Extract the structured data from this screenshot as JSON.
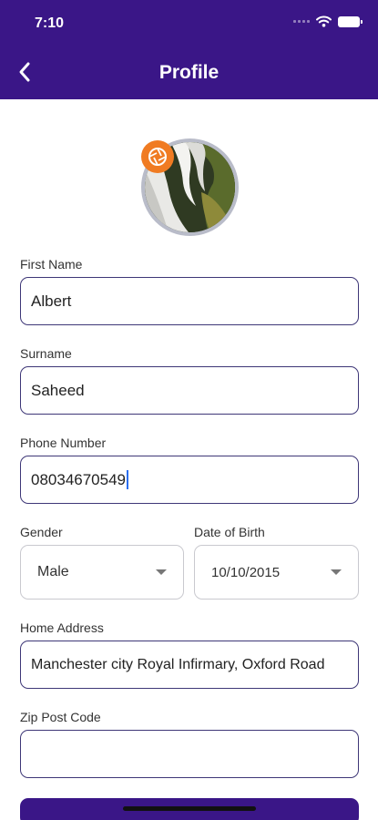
{
  "status_bar": {
    "time": "7:10"
  },
  "header": {
    "title": "Profile"
  },
  "colors": {
    "header_bg": "#3a1687",
    "accent": "#f07b22",
    "field_border": "#3e3777"
  },
  "icons": {
    "back": "chevron-left-icon",
    "camera": "camera-aperture-icon"
  },
  "form": {
    "first_name": {
      "label": "First Name",
      "value": "Albert"
    },
    "surname": {
      "label": "Surname",
      "value": "Saheed"
    },
    "phone": {
      "label": "Phone Number",
      "value": "08034670549"
    },
    "gender": {
      "label": "Gender",
      "value": "Male"
    },
    "dob": {
      "label": "Date of Birth",
      "value": "10/10/2015"
    },
    "address": {
      "label": "Home Address",
      "value": "Manchester city Royal Infirmary, Oxford Road"
    },
    "zip": {
      "label": "Zip Post Code",
      "value": ""
    }
  }
}
